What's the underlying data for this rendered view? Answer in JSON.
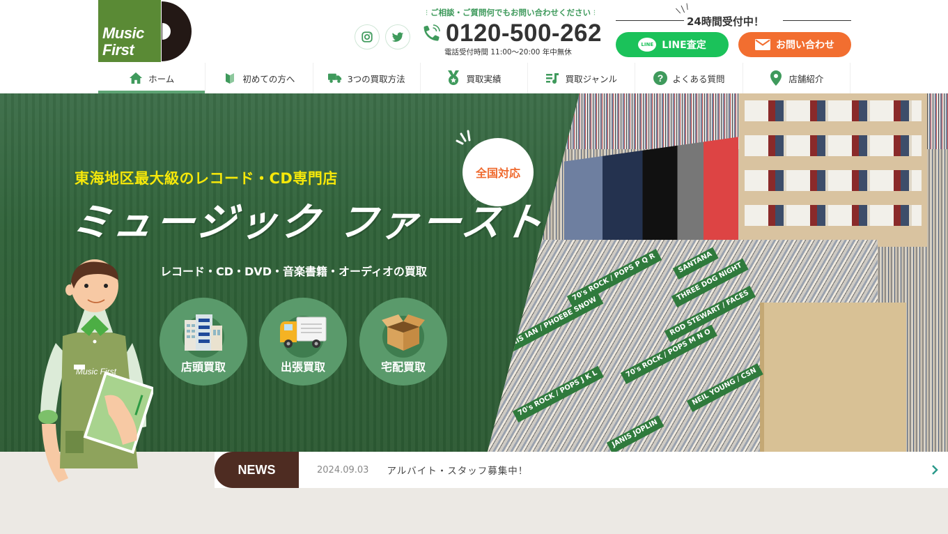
{
  "header": {
    "logo": {
      "line1": "Music",
      "line2": "First"
    },
    "social": [
      {
        "name": "instagram",
        "icon": "instagram-icon"
      },
      {
        "name": "twitter",
        "icon": "twitter-icon"
      }
    ],
    "contact_lead": "ご相談・ご質問何でもお問い合わせください",
    "phone_number": "0120-500-262",
    "phone_hours": "電話受付時間 11:00〜20:00 年中無休",
    "reception_label": "24時間受付中！",
    "line_button": {
      "label": "LINE査定",
      "badge": "LINE"
    },
    "contact_button": {
      "label": "お問い合わせ"
    }
  },
  "nav": {
    "items": [
      {
        "label": "ホーム",
        "icon": "home-icon",
        "active": true
      },
      {
        "label": "初めての方へ",
        "icon": "beginner-mark-icon"
      },
      {
        "label": "3つの買取方法",
        "icon": "truck-icon"
      },
      {
        "label": "買取実績",
        "icon": "medal-icon"
      },
      {
        "label": "買取ジャンル",
        "icon": "music-list-icon"
      },
      {
        "label": "よくある質問",
        "icon": "question-icon"
      },
      {
        "label": "店舗紹介",
        "icon": "map-pin-icon"
      }
    ]
  },
  "hero": {
    "tagline": "東海地区最大級のレコード・CD専門店",
    "title": "ミュージック ファースト",
    "subtitle": "レコード・CD・DVD・音楽書籍・オーディオの買取",
    "bubble": "全国対応",
    "staff_apron_text": "Music First",
    "methods": [
      {
        "label": "店頭買取",
        "icon": "building-icon"
      },
      {
        "label": "出張買取",
        "icon": "delivery-truck-icon"
      },
      {
        "label": "宅配買取",
        "icon": "cardboard-box-icon"
      }
    ],
    "photo_labels": [
      "70's ROCK / POPS P Q R",
      "SANTANA",
      "THREE DOG NIGHT",
      "ROD STEWART / FACES",
      "70's ROCK / POPS M N O",
      "NEIL YOUNG / CSN",
      "70's ROCK / POPS J K L",
      "JANIS JOPLIN",
      "JANIS IAN / PHOEBE SNOW"
    ]
  },
  "news": {
    "label": "NEWS",
    "date": "2024.09.03",
    "title": "アルバイト・スタッフ募集中！"
  },
  "colors": {
    "brand_green": "#5a8a35",
    "nav_icon_green": "#3f9a5c",
    "line_green": "#1bc25a",
    "contact_orange": "#f26e30",
    "tagline_yellow": "#f6e80a",
    "news_brown": "#4e2c22"
  }
}
